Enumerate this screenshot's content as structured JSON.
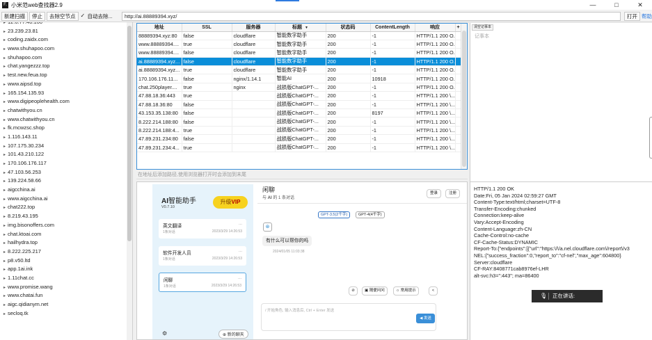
{
  "window": {
    "title": "小米范web查找器2.9",
    "app_icon": "F.",
    "controls": {
      "minimize": "—",
      "maximize": "□",
      "close": "✕"
    }
  },
  "toolbar": {
    "new_scan": "新建扫描",
    "stop": "停止",
    "remove_empty": "去除空节点",
    "auto_remove_label": "自动去除...",
    "auto_remove_checked": true,
    "url_value": "http://ai.88889394.xyz/",
    "open": "打开",
    "help": "帮助"
  },
  "tree": {
    "first_partial": "12.0.77.40.100",
    "items": [
      "23.239.23.81",
      "coding.zaidx.com",
      "www.shuhapoo.com",
      "shuhapoo.com",
      "chat.yangezzz.top",
      "test.new.feua.top",
      "www.aipsd.top",
      "165.154.135.93",
      "www.digipeoplehealth.com",
      "chatwithyou.cn",
      "www.chatwithyou.cn",
      "fk.mcwzsc.shop",
      "1.116.143.11",
      "107.175.30.234",
      "101.43.210.122",
      "170.106.176.117",
      "47.103.56.253",
      "139.224.58.66",
      "aigcchina.ai",
      "www.aigcchina.ai",
      "chat222.top",
      "8.219.43.195",
      "img.bisonoffers.com",
      "chat.ktoai.com",
      "hailhydra.top",
      "8.222.225.217",
      "p8.v50.ltd",
      "app.1ai.ink",
      "1.11chat.cc",
      "www.promise.wang",
      "www.chatai.fun",
      "aigc.qidianym.net",
      "secloq.tk"
    ]
  },
  "results": {
    "columns": [
      "地址",
      "SSL",
      "服务器",
      "标题",
      "状态码",
      "ContentLength",
      "响应",
      "+"
    ],
    "rows": [
      [
        "88889394.xyz:80",
        "false",
        "cloudflare",
        "智能数字助手",
        "200",
        "-1",
        "HTTP/1.1 200 O..."
      ],
      [
        "www.88889394....",
        "true",
        "cloudflare",
        "智能数字助手",
        "200",
        "-1",
        "HTTP/1.1 200 O..."
      ],
      [
        "www.88889394....",
        "false",
        "cloudflare",
        "智能数字助手",
        "200",
        "-1",
        "HTTP/1.1 200 O..."
      ],
      [
        "ai.88889394.xyz...",
        "false",
        "cloudflare",
        "智能数字助手",
        "200",
        "-1",
        "HTTP/1.1 200 O..."
      ],
      [
        "ai.88889394.xyz...",
        "true",
        "cloudflare",
        "智能数字助手",
        "200",
        "-1",
        "HTTP/1.1 200 O..."
      ],
      [
        "170.106.176.11...",
        "false",
        "nginx/1.14.1",
        "智能AI",
        "200",
        "10918",
        "HTTP/1.1 200 O..."
      ],
      [
        "chat.250player....",
        "true",
        "nginx",
        "战损版ChatGPT-...",
        "200",
        "-1",
        "HTTP/1.1 200 O..."
      ],
      [
        "47.88.18.36:443",
        "true",
        "",
        "战损版ChatGPT-...",
        "200",
        "-1",
        "HTTP/1.1 200 \\..."
      ],
      [
        "47.88.18.36:80",
        "false",
        "",
        "战损版ChatGPT-...",
        "200",
        "-1",
        "HTTP/1.1 200 \\..."
      ],
      [
        "43.153.35.138:80",
        "false",
        "",
        "战损版ChatGPT-...",
        "200",
        "8197",
        "HTTP/1.1 200 \\..."
      ],
      [
        "8.222.214.188:80",
        "false",
        "",
        "战损版ChatGPT-...",
        "200",
        "-1",
        "HTTP/1.1 200 \\..."
      ],
      [
        "8.222.214.188:4...",
        "true",
        "",
        "战损版ChatGPT-...",
        "200",
        "-1",
        "HTTP/1.1 200 \\..."
      ],
      [
        "47.89.231.234:80",
        "false",
        "",
        "战损版ChatGPT-...",
        "200",
        "-1",
        "HTTP/1.1 200 \\..."
      ],
      [
        "47.89.231.234:4...",
        "true",
        "",
        "战损版ChatGPT-...",
        "200",
        "-1",
        "HTTP/1.1 200 \\..."
      ]
    ],
    "selected_row": 3,
    "hint": "在地址后添加路径,使用浏览器打开时会添加到末尾"
  },
  "notes": {
    "clear_label": "清空记事本",
    "placeholder": "记事本"
  },
  "webview": {
    "app_name_prefix": "AI",
    "app_name_rest": "智能助手",
    "version": "V0.7.10",
    "vip_prefix": "升级",
    "vip_suffix": "VIP",
    "conversations": [
      {
        "title": "英文翻译",
        "count": "1条对话",
        "time": "2023/3/29 14:26:53",
        "more": "..."
      },
      {
        "title": "软件开发人员",
        "count": "1条对话",
        "time": "2023/3/29 14:26:53",
        "more": "..."
      },
      {
        "title": "闲聊",
        "count": "1条对话",
        "time": "2023/3/29 14:26:53",
        "more": "..."
      }
    ],
    "settings_icon": "⚙",
    "new_chat": "⊕ 新的聊天",
    "chat_title": "闲聊",
    "chat_sub_prefix": "与 ",
    "chat_sub_bold": "AI",
    "chat_sub_suffix": " 的 1 条对话",
    "login": "登录",
    "register": "注册",
    "model_a": "GPT-3.5(2千字)",
    "model_b": "GPT-4(4千字)",
    "bot_icon": "⊛",
    "bot_message": "有什么可以帮你的吗",
    "bot_time": "2024/01/05 11:03:38",
    "tool_clear": "⊘",
    "tool_random": "▣ 随便问问",
    "tool_prompts": "☼ 常用提示",
    "tool_share": "<",
    "input_placeholder": "/ 开始角色, 输入消息后, Ctrl + Enter 发送",
    "send": "◀ 发送"
  },
  "response": {
    "lines": [
      "HTTP/1.1 200 OK",
      "Date:Fri, 05 Jan 2024 02:59:27 GMT",
      "Content-Type:text/html;charset=UTF-8",
      "Transfer-Encoding:chunked",
      "Connection:keep-alive",
      "Vary:Accept-Encoding",
      "Content-Language:zh-CN",
      "Cache-Control:no-cache",
      "CF-Cache-Status:DYNAMIC",
      "Report-To:{\"endpoints\":[{\"url\":\"https:\\/\\/a.nel.cloudflare.com\\/report\\/v3",
      "NEL:{\"success_fraction\":0,\"report_to\":\"cf-nel\",\"max_age\":604800}",
      "Server:cloudflare",
      "CF-RAY:8408771cab8976ef-LHR",
      "alt-svc:h3=\":443\"; ma=86400"
    ],
    "voice_icon": "🎙",
    "voice_text": "正在讲话:"
  },
  "colors": {
    "selection": "#0a8ed9",
    "vip": "#f7d21f",
    "accent": "#3a8fd8"
  }
}
